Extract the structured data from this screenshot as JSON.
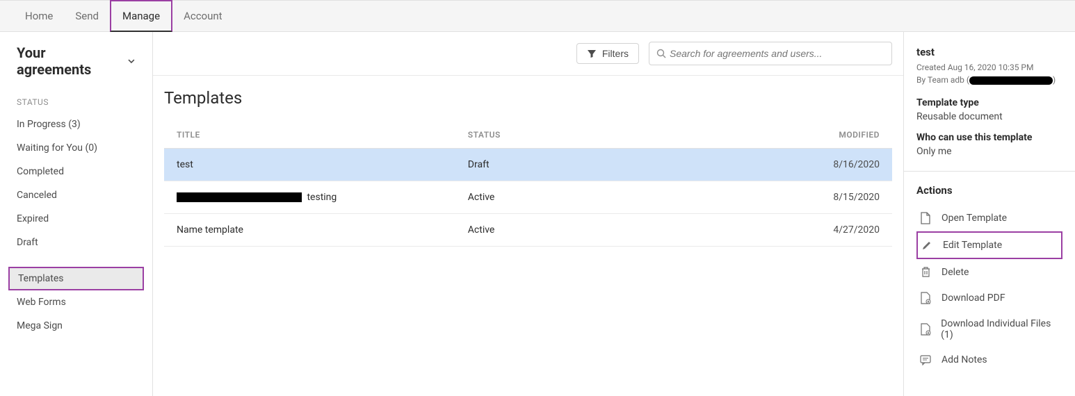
{
  "topnav": {
    "items": [
      {
        "label": "Home"
      },
      {
        "label": "Send"
      },
      {
        "label": "Manage",
        "active": true,
        "highlight": true
      },
      {
        "label": "Account"
      }
    ]
  },
  "page_title": "Your agreements",
  "sidebar": {
    "status_header": "STATUS",
    "status_items": [
      {
        "label": "In Progress (3)"
      },
      {
        "label": "Waiting for You (0)"
      },
      {
        "label": "Completed"
      },
      {
        "label": "Canceled"
      },
      {
        "label": "Expired"
      },
      {
        "label": "Draft"
      }
    ],
    "other_items": [
      {
        "label": "Templates",
        "selected": true,
        "highlight": true
      },
      {
        "label": "Web Forms"
      },
      {
        "label": "Mega Sign"
      }
    ]
  },
  "toolbar": {
    "filters_label": "Filters",
    "search_placeholder": "Search for agreements and users..."
  },
  "content": {
    "heading": "Templates",
    "columns": {
      "title": "TITLE",
      "status": "STATUS",
      "modified": "MODIFIED"
    },
    "rows": [
      {
        "title": "test",
        "status": "Draft",
        "modified": "8/16/2020",
        "selected": true
      },
      {
        "title_suffix": " testing",
        "redacted_prefix": true,
        "status": "Active",
        "modified": "8/15/2020"
      },
      {
        "title": "Name template",
        "status": "Active",
        "modified": "4/27/2020"
      }
    ]
  },
  "detail": {
    "title": "test",
    "created_line": "Created Aug 16, 2020 10:35 PM",
    "by_prefix": "By Team adb (",
    "by_suffix": ")",
    "template_type_label": "Template type",
    "template_type_value": "Reusable document",
    "who_can_use_label": "Who can use this template",
    "who_can_use_value": "Only me",
    "actions_header": "Actions",
    "actions": [
      {
        "label": "Open Template",
        "icon": "document-icon"
      },
      {
        "label": "Edit Template",
        "icon": "pencil-icon",
        "highlight": true
      },
      {
        "label": "Delete",
        "icon": "trash-icon"
      },
      {
        "label": "Download PDF",
        "icon": "download-pdf-icon"
      },
      {
        "label": "Download Individual Files (1)",
        "icon": "download-files-icon"
      },
      {
        "label": "Add Notes",
        "icon": "note-icon"
      }
    ]
  }
}
